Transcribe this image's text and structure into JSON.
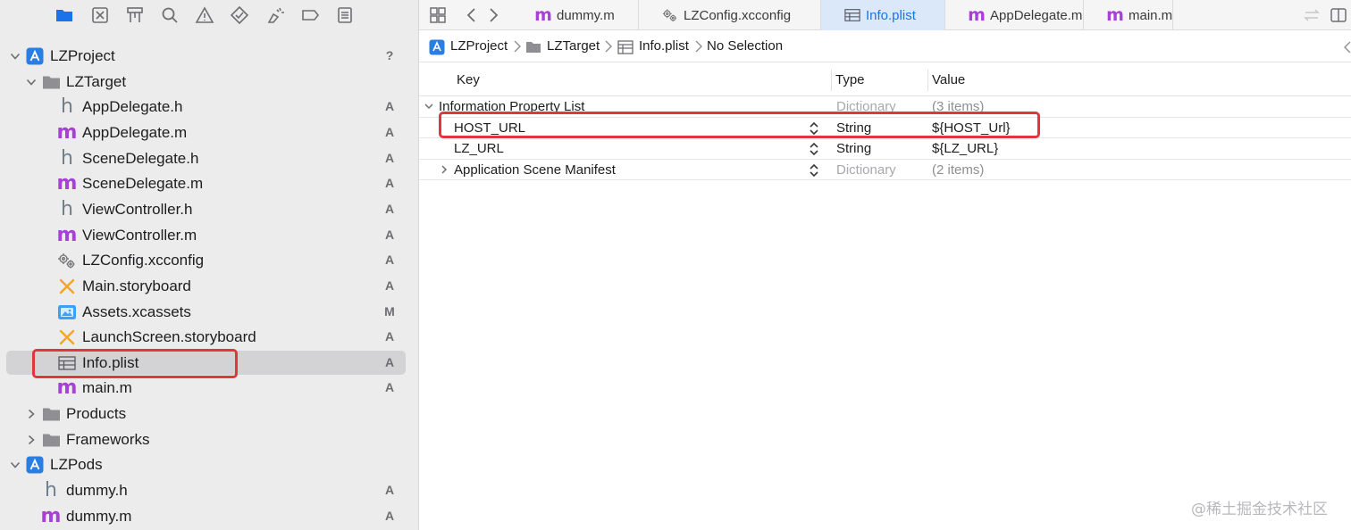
{
  "navigator": {
    "tree": [
      {
        "name": "LZProject",
        "status": "?",
        "kind": "project",
        "indent": 0,
        "disclosure": "open"
      },
      {
        "name": "LZTarget",
        "status": "",
        "kind": "folder",
        "indent": 1,
        "disclosure": "open"
      },
      {
        "name": "AppDelegate.h",
        "status": "A",
        "kind": "h",
        "indent": 2
      },
      {
        "name": "AppDelegate.m",
        "status": "A",
        "kind": "m",
        "indent": 2
      },
      {
        "name": "SceneDelegate.h",
        "status": "A",
        "kind": "h",
        "indent": 2
      },
      {
        "name": "SceneDelegate.m",
        "status": "A",
        "kind": "m",
        "indent": 2
      },
      {
        "name": "ViewController.h",
        "status": "A",
        "kind": "h",
        "indent": 2
      },
      {
        "name": "ViewController.m",
        "status": "A",
        "kind": "m",
        "indent": 2
      },
      {
        "name": "LZConfig.xcconfig",
        "status": "A",
        "kind": "xcconfig",
        "indent": 2
      },
      {
        "name": "Main.storyboard",
        "status": "A",
        "kind": "storyboard",
        "indent": 2
      },
      {
        "name": "Assets.xcassets",
        "status": "M",
        "kind": "assets",
        "indent": 2
      },
      {
        "name": "LaunchScreen.storyboard",
        "status": "A",
        "kind": "storyboard",
        "indent": 2
      },
      {
        "name": "Info.plist",
        "status": "A",
        "kind": "plist",
        "indent": 2,
        "selected": true
      },
      {
        "name": "main.m",
        "status": "A",
        "kind": "m",
        "indent": 2
      },
      {
        "name": "Products",
        "status": "",
        "kind": "folder",
        "indent": 1,
        "disclosure": "closed"
      },
      {
        "name": "Frameworks",
        "status": "",
        "kind": "folder",
        "indent": 1,
        "disclosure": "closed"
      },
      {
        "name": "LZPods",
        "status": "",
        "kind": "project",
        "indent": 0,
        "disclosure": "open"
      },
      {
        "name": "dummy.h",
        "status": "A",
        "kind": "h",
        "indent": 1
      },
      {
        "name": "dummy.m",
        "status": "A",
        "kind": "m",
        "indent": 1
      }
    ]
  },
  "tabs": [
    {
      "label": "dummy.m",
      "kind": "m"
    },
    {
      "label": "LZConfig.xcconfig",
      "kind": "xcconfig"
    },
    {
      "label": "Info.plist",
      "kind": "plist",
      "active": true
    },
    {
      "label": "AppDelegate.m",
      "kind": "m"
    },
    {
      "label": "main.m",
      "kind": "m"
    }
  ],
  "jumpbar": {
    "project": "LZProject",
    "group": "LZTarget",
    "file": "Info.plist",
    "selection": "No Selection"
  },
  "plist": {
    "headers": {
      "key": "Key",
      "type": "Type",
      "value": "Value"
    },
    "rows": [
      {
        "key": "Information Property List",
        "type": "Dictionary",
        "value": "(3 items)",
        "level": 0,
        "disclosure": "open"
      },
      {
        "key": "HOST_URL",
        "type": "String",
        "value": "${HOST_Url}",
        "level": 1
      },
      {
        "key": "LZ_URL",
        "type": "String",
        "value": "${LZ_URL}",
        "level": 1
      },
      {
        "key": "Application Scene Manifest",
        "type": "Dictionary",
        "value": "(2 items)",
        "level": 1,
        "disclosure": "closed"
      }
    ]
  },
  "watermark": "@稀土掘金技术社区",
  "colors": {
    "accent": "#1a73e8",
    "highlight": "#e0363c",
    "m_file": "#a83fd8",
    "h_file": "#6e7f8e"
  }
}
